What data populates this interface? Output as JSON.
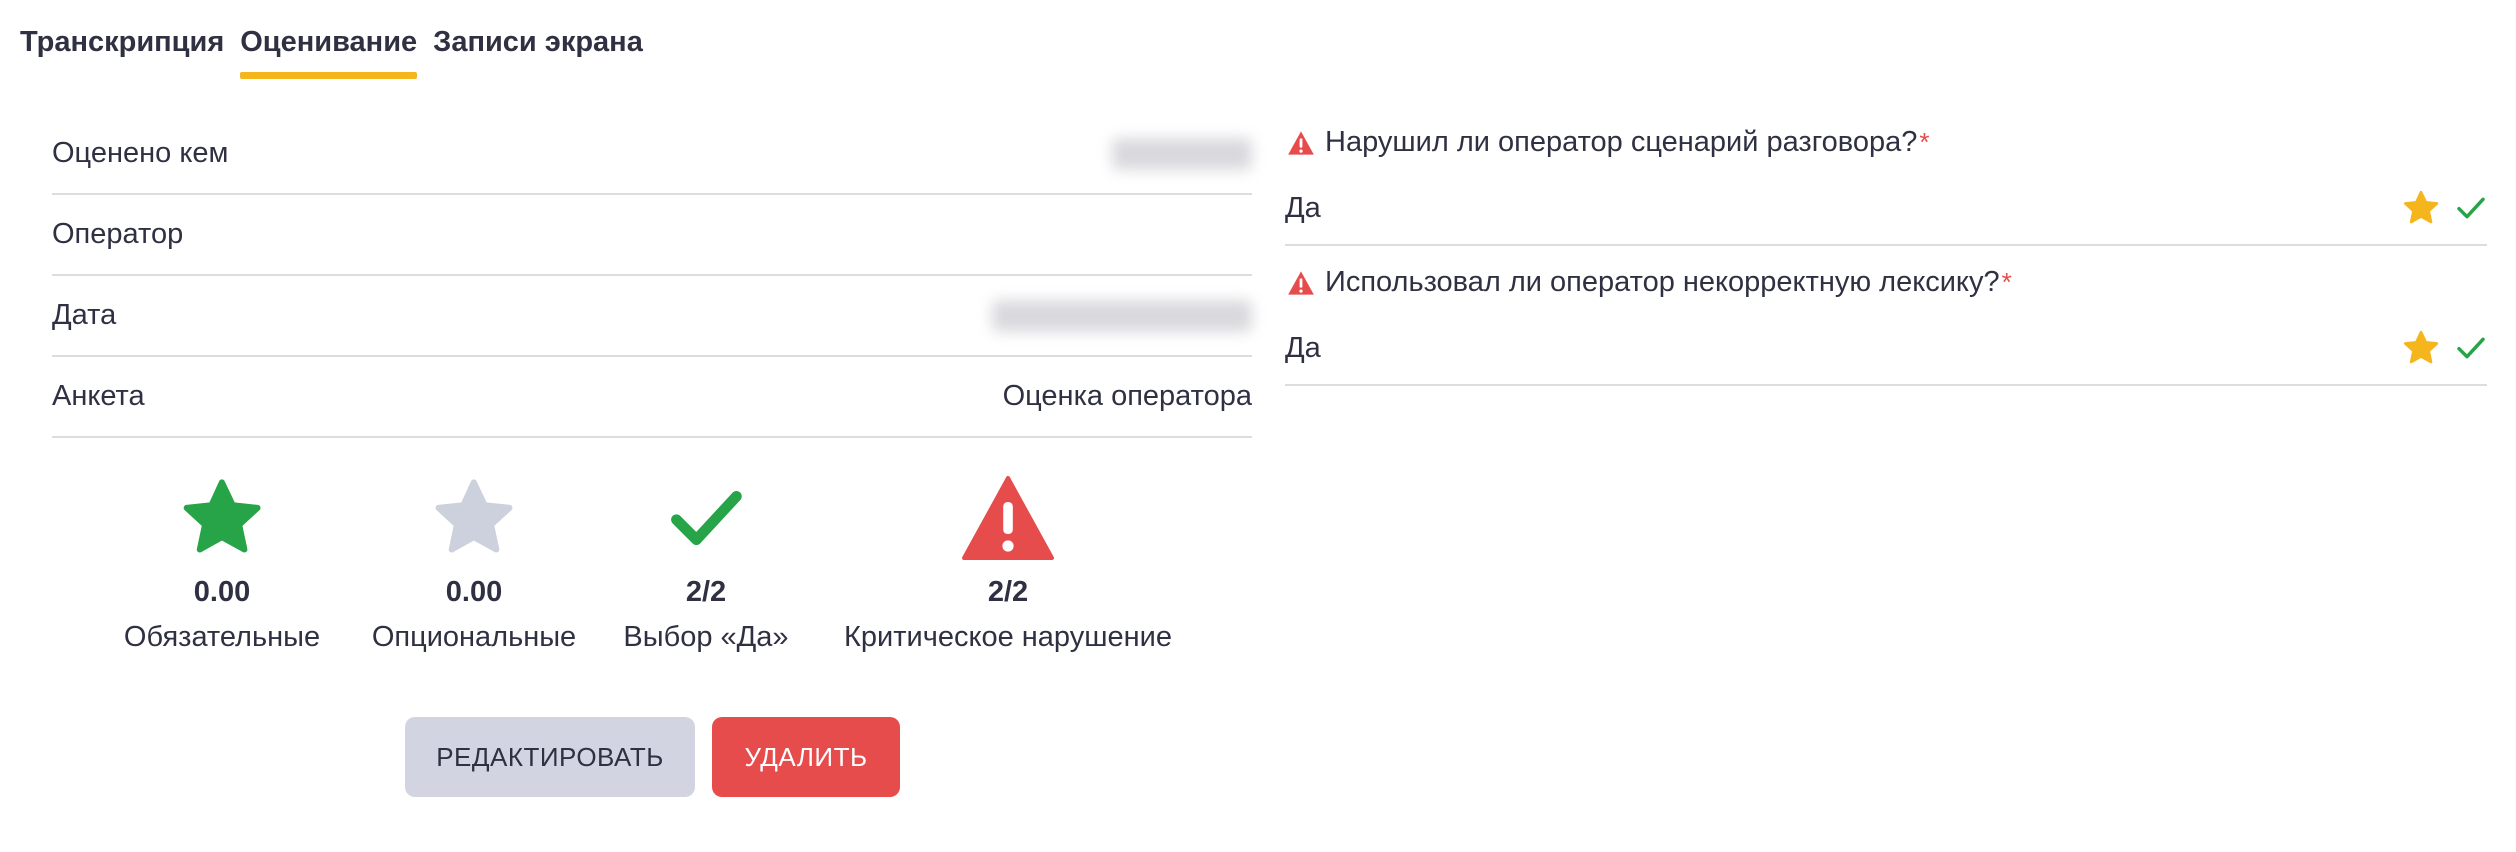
{
  "tabs": [
    {
      "label": "Транскрипция",
      "active": false
    },
    {
      "label": "Оценивание",
      "active": true
    },
    {
      "label": "Записи экрана",
      "active": false
    }
  ],
  "info_rows": [
    {
      "label": "Оценено кем",
      "value": ""
    },
    {
      "label": "Оператор",
      "value": ""
    },
    {
      "label": "Дата",
      "value": ""
    },
    {
      "label": "Анкета",
      "value": "Оценка оператора"
    }
  ],
  "stats": [
    {
      "icon": "star-icon",
      "value": "0.00",
      "label": "Обязательные",
      "color": "#27a348"
    },
    {
      "icon": "star-icon",
      "value": "0.00",
      "label": "Опциональные",
      "color": "#cdd0dd"
    },
    {
      "icon": "checkmark-icon",
      "value": "2/2",
      "label": "Выбор «Да»",
      "color": "#27a348"
    },
    {
      "icon": "warning-icon",
      "value": "2/2",
      "label": "Критическое нарушение",
      "color": "#e74c4c"
    }
  ],
  "buttons": {
    "edit_label": "РЕДАКТИРОВАТЬ",
    "delete_label": "УДАЛИТЬ"
  },
  "questions": [
    {
      "title": "Нарушил ли оператор сценарий разговора?",
      "required_mark": "*",
      "answer": "Да"
    },
    {
      "title": "Использовал ли оператор некорректную лексику?",
      "required_mark": "*",
      "answer": "Да"
    }
  ],
  "colors": {
    "accent": "#f5b51c",
    "success": "#27a348",
    "danger": "#e74c4c",
    "muted": "#cdd0dd"
  }
}
